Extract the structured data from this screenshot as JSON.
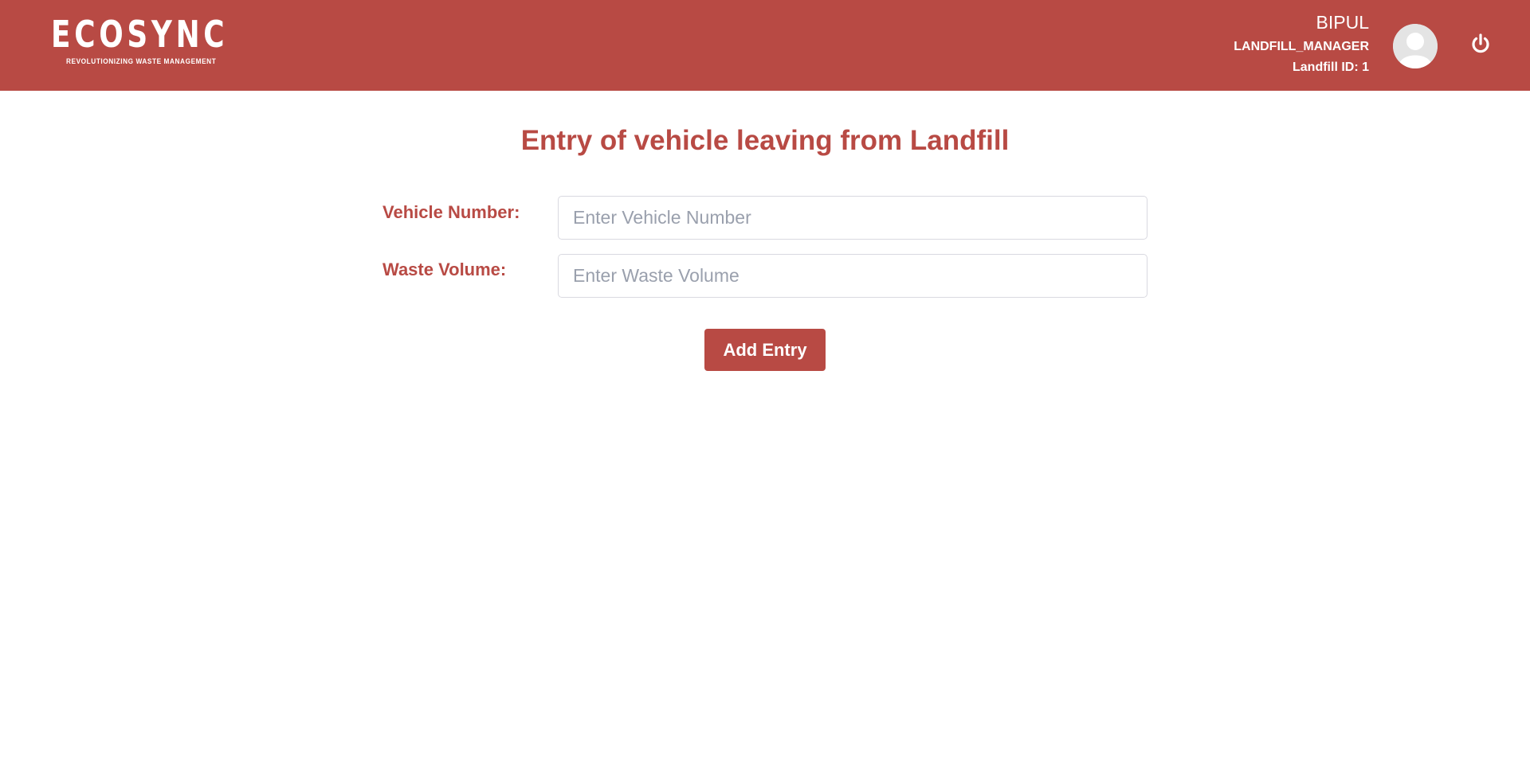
{
  "header": {
    "logo_text": "ECOSYNC",
    "logo_tagline": "REVOLUTIONIZING WASTE MANAGEMENT",
    "user_name": "BIPUL",
    "user_role": "LANDFILL_MANAGER",
    "landfill_id": "Landfill ID: 1",
    "avatar_icon": "user-avatar-icon",
    "logout_icon": "power-icon"
  },
  "page": {
    "title": "Entry of vehicle leaving from Landfill"
  },
  "form": {
    "vehicle_number_label": "Vehicle Number:",
    "vehicle_number_placeholder": "Enter Vehicle Number",
    "vehicle_number_value": "",
    "waste_volume_label": "Waste Volume:",
    "waste_volume_placeholder": "Enter Waste Volume",
    "waste_volume_value": "",
    "submit_label": "Add Entry"
  },
  "colors": {
    "brand": "#b84a44",
    "background": "#ffffff",
    "placeholder": "#9aa0ad"
  }
}
